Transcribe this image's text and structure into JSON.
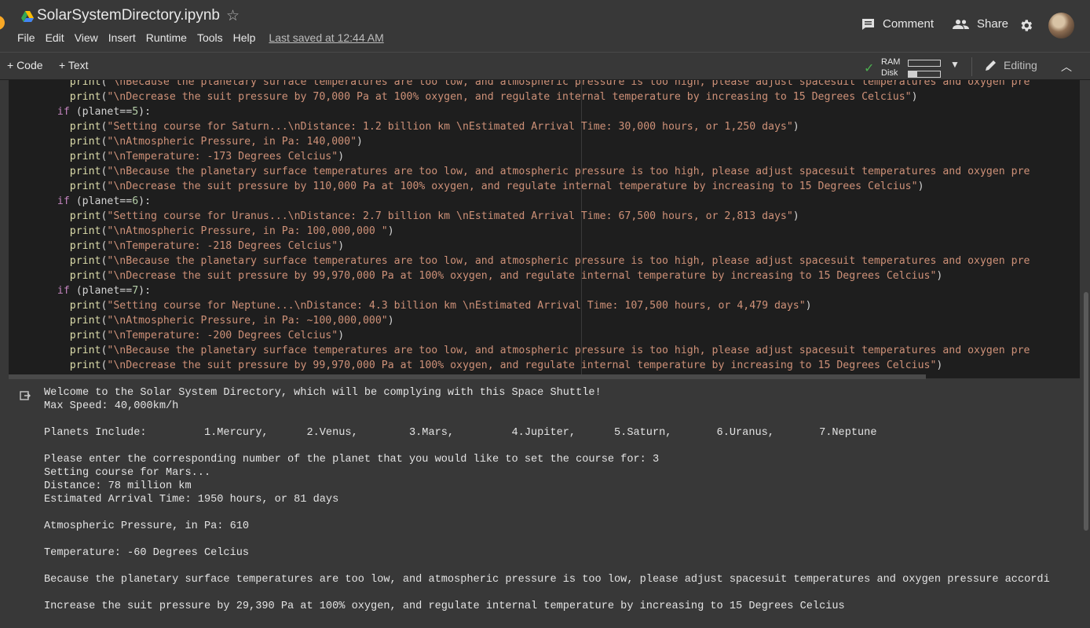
{
  "header": {
    "title": "SolarSystemDirectory.ipynb",
    "menu": [
      "File",
      "Edit",
      "View",
      "Insert",
      "Runtime",
      "Tools",
      "Help"
    ],
    "last_saved": "Last saved at 12:44 AM",
    "comment_label": "Comment",
    "share_label": "Share"
  },
  "toolbar": {
    "add_code": "+ Code",
    "add_text": "+ Text",
    "ram_label": "RAM",
    "disk_label": "Disk",
    "editing_label": "Editing"
  },
  "code_lines": [
    [
      {
        "t": "    "
      },
      {
        "t": "print",
        "c": "fn"
      },
      {
        "t": "("
      },
      {
        "t": "\"\\nBecause the planetary surface temperatures are too low, and atmospheric pressure is too high, please adjust spacesuit temperatures and oxygen pre",
        "c": "str"
      }
    ],
    [
      {
        "t": "    "
      },
      {
        "t": "print",
        "c": "fn"
      },
      {
        "t": "("
      },
      {
        "t": "\"\\nDecrease the suit pressure by 70,000 Pa at 100% oxygen, and regulate internal temperature by increasing to 15 Degrees Celcius\"",
        "c": "str"
      },
      {
        "t": ")"
      }
    ],
    [
      {
        "t": "  "
      },
      {
        "t": "if",
        "c": "kw"
      },
      {
        "t": " (planet=="
      },
      {
        "t": "5",
        "c": "num"
      },
      {
        "t": "):"
      }
    ],
    [
      {
        "t": "    "
      },
      {
        "t": "print",
        "c": "fn"
      },
      {
        "t": "("
      },
      {
        "t": "\"Setting course for Saturn...\\nDistance: 1.2 billion km \\nEstimated Arrival Time: 30,000 hours, or 1,250 days\"",
        "c": "str"
      },
      {
        "t": ")"
      }
    ],
    [
      {
        "t": "    "
      },
      {
        "t": "print",
        "c": "fn"
      },
      {
        "t": "("
      },
      {
        "t": "\"\\nAtmospheric Pressure, in Pa: 140,000\"",
        "c": "str"
      },
      {
        "t": ")"
      }
    ],
    [
      {
        "t": "    "
      },
      {
        "t": "print",
        "c": "fn"
      },
      {
        "t": "("
      },
      {
        "t": "\"\\nTemperature: -173 Degrees Celcius\"",
        "c": "str"
      },
      {
        "t": ")"
      }
    ],
    [
      {
        "t": "    "
      },
      {
        "t": "print",
        "c": "fn"
      },
      {
        "t": "("
      },
      {
        "t": "\"\\nBecause the planetary surface temperatures are too low, and atmospheric pressure is too high, please adjust spacesuit temperatures and oxygen pre",
        "c": "str"
      }
    ],
    [
      {
        "t": "    "
      },
      {
        "t": "print",
        "c": "fn"
      },
      {
        "t": "("
      },
      {
        "t": "\"\\nDecrease the suit pressure by 110,000 Pa at 100% oxygen, and regulate internal temperature by increasing to 15 Degrees Celcius\"",
        "c": "str"
      },
      {
        "t": ")"
      }
    ],
    [
      {
        "t": "  "
      },
      {
        "t": "if",
        "c": "kw"
      },
      {
        "t": " (planet=="
      },
      {
        "t": "6",
        "c": "num"
      },
      {
        "t": "):"
      }
    ],
    [
      {
        "t": "    "
      },
      {
        "t": "print",
        "c": "fn"
      },
      {
        "t": "("
      },
      {
        "t": "\"Setting course for Uranus...\\nDistance: 2.7 billion km \\nEstimated Arrival Time: 67,500 hours, or 2,813 days\"",
        "c": "str"
      },
      {
        "t": ")"
      }
    ],
    [
      {
        "t": "    "
      },
      {
        "t": "print",
        "c": "fn"
      },
      {
        "t": "("
      },
      {
        "t": "\"\\nAtmospheric Pressure, in Pa: 100,000,000 \"",
        "c": "str"
      },
      {
        "t": ")"
      }
    ],
    [
      {
        "t": "    "
      },
      {
        "t": "print",
        "c": "fn"
      },
      {
        "t": "("
      },
      {
        "t": "\"\\nTemperature: -218 Degrees Celcius\"",
        "c": "str"
      },
      {
        "t": ")"
      }
    ],
    [
      {
        "t": "    "
      },
      {
        "t": "print",
        "c": "fn"
      },
      {
        "t": "("
      },
      {
        "t": "\"\\nBecause the planetary surface temperatures are too low, and atmospheric pressure is too high, please adjust spacesuit temperatures and oxygen pre",
        "c": "str"
      }
    ],
    [
      {
        "t": "    "
      },
      {
        "t": "print",
        "c": "fn"
      },
      {
        "t": "("
      },
      {
        "t": "\"\\nDecrease the suit pressure by 99,970,000 Pa at 100% oxygen, and regulate internal temperature by increasing to 15 Degrees Celcius\"",
        "c": "str"
      },
      {
        "t": ")"
      }
    ],
    [
      {
        "t": "  "
      },
      {
        "t": "if",
        "c": "kw"
      },
      {
        "t": " (planet=="
      },
      {
        "t": "7",
        "c": "num"
      },
      {
        "t": "):"
      }
    ],
    [
      {
        "t": "    "
      },
      {
        "t": "print",
        "c": "fn"
      },
      {
        "t": "("
      },
      {
        "t": "\"Setting course for Neptune...\\nDistance: 4.3 billion km \\nEstimated Arrival Time: 107,500 hours, or 4,479 days\"",
        "c": "str"
      },
      {
        "t": ")"
      }
    ],
    [
      {
        "t": "    "
      },
      {
        "t": "print",
        "c": "fn"
      },
      {
        "t": "("
      },
      {
        "t": "\"\\nAtmospheric Pressure, in Pa: ~100,000,000\"",
        "c": "str"
      },
      {
        "t": ")"
      }
    ],
    [
      {
        "t": "    "
      },
      {
        "t": "print",
        "c": "fn"
      },
      {
        "t": "("
      },
      {
        "t": "\"\\nTemperature: -200 Degrees Celcius\"",
        "c": "str"
      },
      {
        "t": ")"
      }
    ],
    [
      {
        "t": "    "
      },
      {
        "t": "print",
        "c": "fn"
      },
      {
        "t": "("
      },
      {
        "t": "\"\\nBecause the planetary surface temperatures are too low, and atmospheric pressure is too high, please adjust spacesuit temperatures and oxygen pre",
        "c": "str"
      }
    ],
    [
      {
        "t": "    "
      },
      {
        "t": "print",
        "c": "fn"
      },
      {
        "t": "("
      },
      {
        "t": "\"\\nDecrease the suit pressure by 99,970,000 Pa at 100% oxygen, and regulate internal temperature by increasing to 15 Degrees Celcius\"",
        "c": "str"
      },
      {
        "t": ")"
      }
    ]
  ],
  "output_lines": [
    "Welcome to the Solar System Directory, which will be complying with this Space Shuttle!",
    "Max Speed: 40,000km/h",
    "",
    "Planets Include:         1.Mercury,      2.Venus,        3.Mars,         4.Jupiter,      5.Saturn,       6.Uranus,       7.Neptune",
    "",
    "Please enter the corresponding number of the planet that you would like to set the course for: 3",
    "Setting course for Mars...",
    "Distance: 78 million km",
    "Estimated Arrival Time: 1950 hours, or 81 days",
    "",
    "Atmospheric Pressure, in Pa: 610",
    "",
    "Temperature: -60 Degrees Celcius",
    "",
    "Because the planetary surface temperatures are too low, and atmospheric pressure is too low, please adjust spacesuit temperatures and oxygen pressure accordi",
    "",
    "Increase the suit pressure by 29,390 Pa at 100% oxygen, and regulate internal temperature by increasing to 15 Degrees Celcius"
  ],
  "resources": {
    "ram_usage": 0.0,
    "disk_usage": 0.28
  },
  "colors": {
    "keyword": "#c586c0",
    "function": "#dcdcaa",
    "string": "#ce9178",
    "number": "#b5cea8",
    "ok_check": "#4caf50"
  }
}
